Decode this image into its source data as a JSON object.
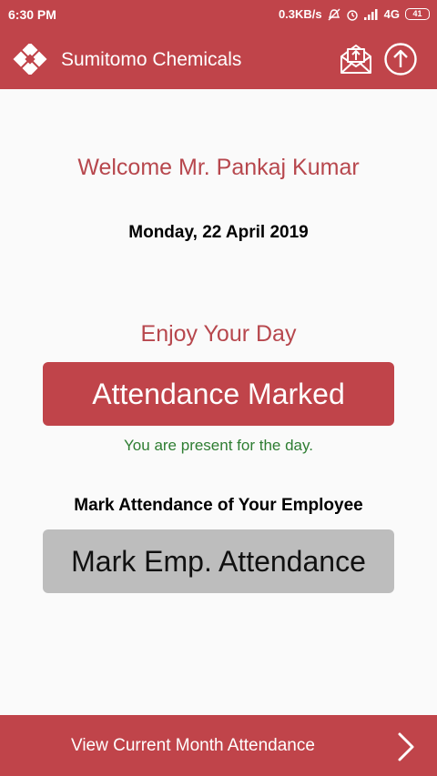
{
  "status": {
    "time": "6:30 PM",
    "speed": "0.3KB/s",
    "network": "4G",
    "battery": "41"
  },
  "toolbar": {
    "title": "Sumitomo Chemicals"
  },
  "main": {
    "welcome": "Welcome Mr. Pankaj Kumar",
    "date": "Monday, 22 April 2019",
    "enjoy": "Enjoy Your Day",
    "attendance_button": "Attendance Marked",
    "present_text": "You are present for the day.",
    "employee_label": "Mark Attendance of Your Employee",
    "employee_button": "Mark Emp. Attendance"
  },
  "bottom": {
    "label": "View Current Month Attendance"
  },
  "colors": {
    "primary": "#c0444a",
    "welcome_text": "#b7474d",
    "present_text": "#2e7d32",
    "secondary_button": "#bdbdbd"
  }
}
